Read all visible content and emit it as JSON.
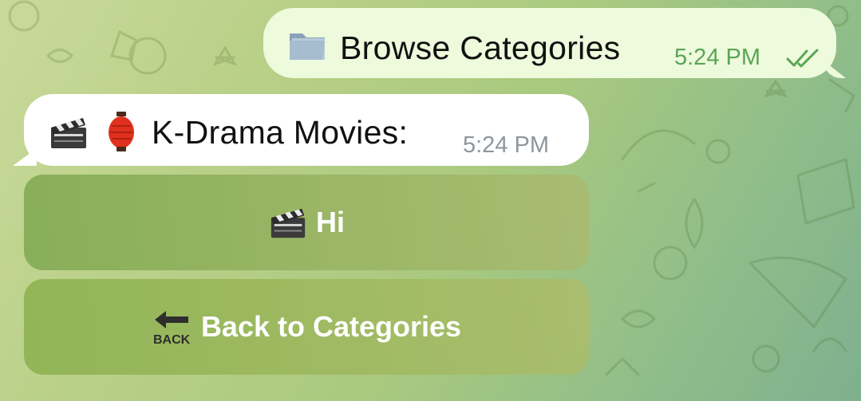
{
  "chat": {
    "outgoing": {
      "emoji_icon": "file-folder-icon",
      "text": "Browse Categories",
      "time": "5:24 PM",
      "status_icon": "double-check-icon",
      "bubble_color": "#eefadc",
      "time_color": "#5aa556"
    },
    "incoming": {
      "emoji_icons": [
        "clapper-board-icon",
        "red-lantern-icon"
      ],
      "text": "K-Drama Movies:",
      "time": "5:24 PM",
      "bubble_color": "#ffffff",
      "time_color": "#8e969c"
    },
    "keyboard": {
      "buttons": [
        {
          "icon": "clapper-board-icon",
          "label": "Hi"
        },
        {
          "icon": "back-arrow-icon",
          "label": "Back to Categories"
        }
      ]
    }
  }
}
